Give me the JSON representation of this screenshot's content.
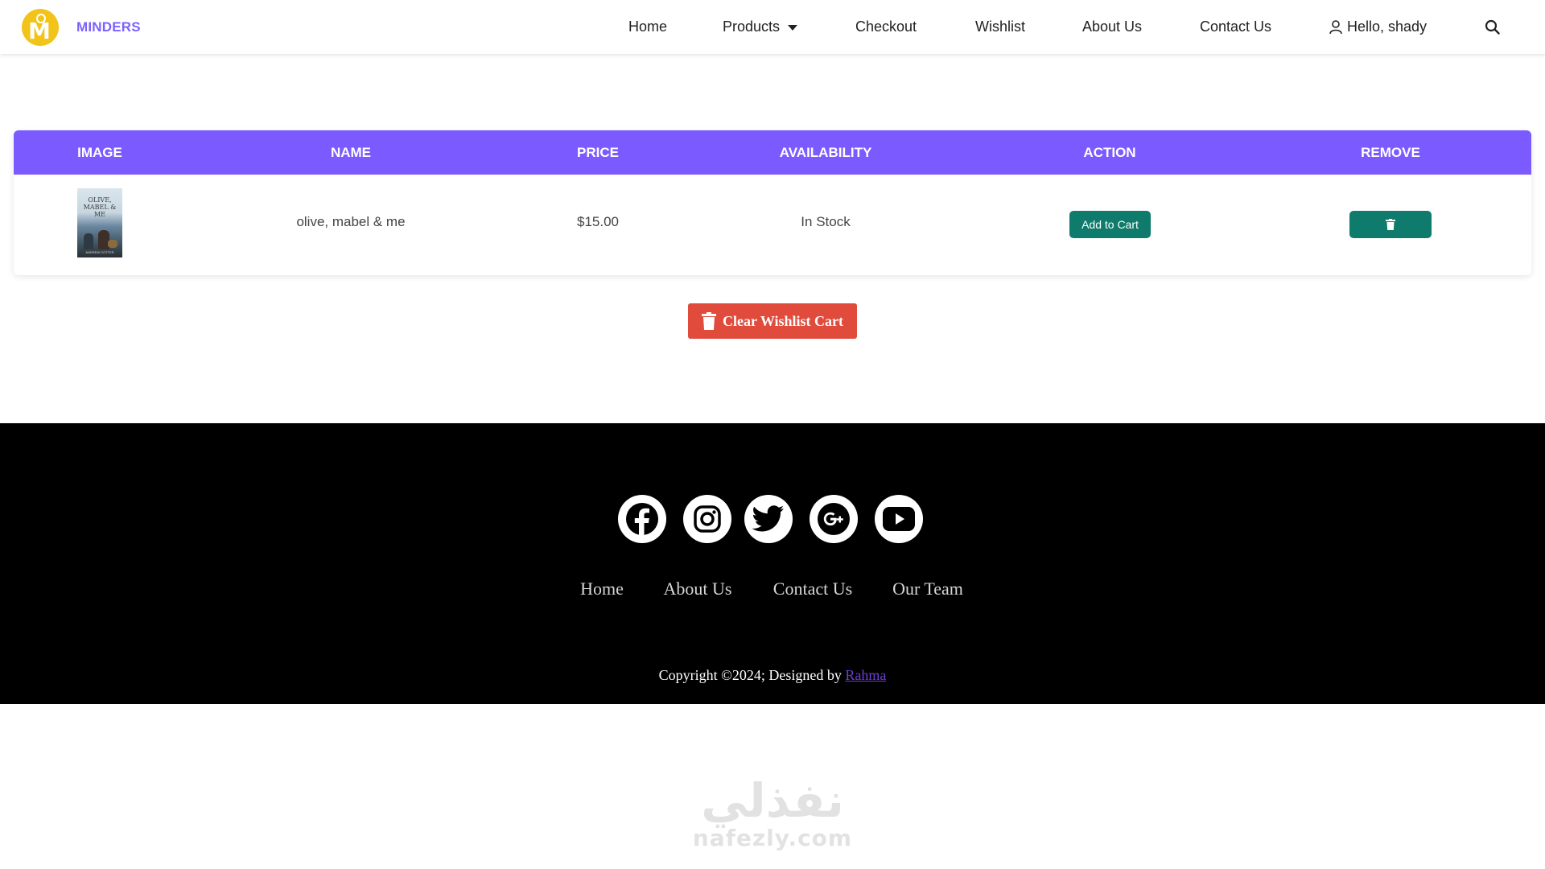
{
  "brand": {
    "name": "MINDERS"
  },
  "nav": {
    "home": "Home",
    "products": "Products",
    "checkout": "Checkout",
    "wishlist": "Wishlist",
    "about": "About Us",
    "contact": "Contact Us",
    "user": "Hello, shady"
  },
  "wishlist_table": {
    "headers": [
      "IMAGE",
      "NAME",
      "PRICE",
      "AVAILABILITY",
      "ACTION",
      "REMOVE"
    ],
    "rows": [
      {
        "cover_title": "OLIVE, MABEL & ME",
        "cover_author": "ANDREW COTTER",
        "name": "olive, mabel & me",
        "price": "$15.00",
        "availability": "In Stock",
        "action_label": "Add to Cart"
      }
    ]
  },
  "clear_button": "Clear Wishlist Cart",
  "footer": {
    "social_icons": [
      "facebook-icon",
      "instagram-icon",
      "twitter-icon",
      "google-plus-icon",
      "youtube-icon"
    ],
    "links": [
      "Home",
      "About Us",
      "Contact Us",
      "Our Team"
    ],
    "copyright": "Copyright ©2024; Designed by ",
    "designer": "Rahma"
  },
  "watermark": {
    "arabic": "نفذلي",
    "latin": "nafezly.com"
  },
  "colors": {
    "brand_purple": "#7b61ff",
    "table_header": "#7b5bff",
    "action_green": "#0f7b6c",
    "clear_red": "#e04b3c",
    "logo_yellow": "#f2c318"
  }
}
